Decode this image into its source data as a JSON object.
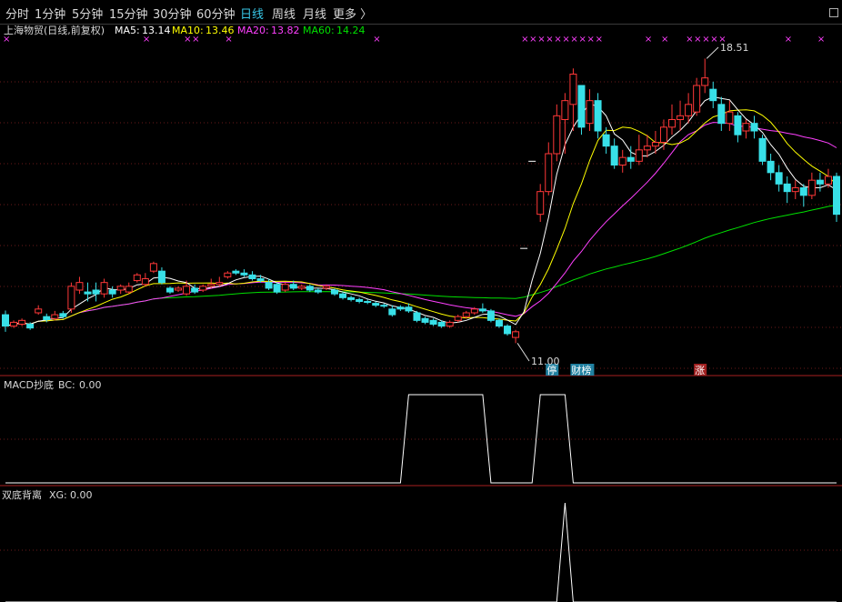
{
  "toolbar": {
    "periods": [
      {
        "label": "分时",
        "x": 6
      },
      {
        "label": "1分钟",
        "x": 38
      },
      {
        "label": "5分钟",
        "x": 79
      },
      {
        "label": "15分钟",
        "x": 120
      },
      {
        "label": "30分钟",
        "x": 168
      },
      {
        "label": "60分钟",
        "x": 216
      },
      {
        "label": "日线",
        "x": 264,
        "active": true
      },
      {
        "label": "周线",
        "x": 299
      },
      {
        "label": "月线",
        "x": 333
      },
      {
        "label": "更多 〉",
        "x": 366
      }
    ]
  },
  "colors": {
    "up": "#ff3838",
    "down": "#38e0e8",
    "ma5": "#ffffff",
    "ma10": "#ffff00",
    "ma20": "#ff40ff",
    "ma60": "#00e000",
    "frame": "#a82020",
    "grid": "#6a1a1a",
    "signal": "#ffffff",
    "marker": "#ff40ff"
  },
  "main_panel": {
    "name": "上海物贸(日线,前复权)",
    "legend": [
      {
        "label": "MA5:",
        "value": "13.14",
        "color": "#ffffff"
      },
      {
        "label": "MA10:",
        "value": "13.46",
        "color": "#ffff00"
      },
      {
        "label": "MA20:",
        "value": "13.82",
        "color": "#ff40ff"
      },
      {
        "label": "MA60:",
        "value": "14.24",
        "color": "#00e000"
      }
    ],
    "high_label": "18.51",
    "low_label": "11.00",
    "event_tags": [
      {
        "text": "停",
        "index": 66,
        "bg": "#2080a0",
        "fg": "#ffffff"
      },
      {
        "text": "财榜",
        "index": 69,
        "bg": "#2080a0",
        "fg": "#ffffff"
      },
      {
        "text": "涨",
        "index": 84,
        "bg": "#a02020",
        "fg": "#ffffff"
      }
    ],
    "markers_top": [
      0,
      17,
      22,
      23,
      27,
      45,
      63,
      64,
      65,
      66,
      67,
      68,
      69,
      70,
      71,
      72,
      78,
      80,
      83,
      84,
      85,
      86,
      87,
      95,
      99
    ]
  },
  "macd_panel": {
    "title": "MACD抄底",
    "indicator": "BC:",
    "value": "0.00"
  },
  "xg_panel": {
    "title": "双底背离",
    "indicator": "XG:",
    "value": "0.00"
  },
  "chart_data": {
    "type": "candlestick",
    "ylim": [
      10.6,
      19.0
    ],
    "candles": [
      [
        11.75,
        11.45,
        11.86,
        11.3
      ],
      [
        11.45,
        11.55,
        11.6,
        11.4
      ],
      [
        11.5,
        11.6,
        11.65,
        11.45
      ],
      [
        11.5,
        11.4,
        11.55,
        11.35
      ],
      [
        11.8,
        11.9,
        12.0,
        11.75
      ],
      [
        11.7,
        11.62,
        11.78,
        11.55
      ],
      [
        11.65,
        11.75,
        11.85,
        11.6
      ],
      [
        11.78,
        11.7,
        11.85,
        11.65
      ],
      [
        11.9,
        12.5,
        12.6,
        11.8
      ],
      [
        12.4,
        12.6,
        12.75,
        12.3
      ],
      [
        12.35,
        12.3,
        12.6,
        12.1
      ],
      [
        12.4,
        12.3,
        12.6,
        12.1
      ],
      [
        12.3,
        12.6,
        12.7,
        12.2
      ],
      [
        12.4,
        12.3,
        12.5,
        12.2
      ],
      [
        12.4,
        12.5,
        12.55,
        12.3
      ],
      [
        12.35,
        12.5,
        12.6,
        12.3
      ],
      [
        12.65,
        12.8,
        12.85,
        12.6
      ],
      [
        12.55,
        12.7,
        12.85,
        12.5
      ],
      [
        12.9,
        13.1,
        13.15,
        12.85
      ],
      [
        12.9,
        12.6,
        13.0,
        12.55
      ],
      [
        12.45,
        12.35,
        12.5,
        12.3
      ],
      [
        12.4,
        12.45,
        12.5,
        12.35
      ],
      [
        12.3,
        12.5,
        12.65,
        12.25
      ],
      [
        12.45,
        12.35,
        12.55,
        12.3
      ],
      [
        12.4,
        12.5,
        12.55,
        12.35
      ],
      [
        12.5,
        12.55,
        12.7,
        12.45
      ],
      [
        12.55,
        12.6,
        12.75,
        12.5
      ],
      [
        12.75,
        12.85,
        12.9,
        12.7
      ],
      [
        12.9,
        12.85,
        12.95,
        12.8
      ],
      [
        12.85,
        12.8,
        12.95,
        12.75
      ],
      [
        12.8,
        12.7,
        12.9,
        12.65
      ],
      [
        12.7,
        12.65,
        12.8,
        12.6
      ],
      [
        12.6,
        12.45,
        12.7,
        12.4
      ],
      [
        12.55,
        12.35,
        12.6,
        12.3
      ],
      [
        12.4,
        12.55,
        12.6,
        12.35
      ],
      [
        12.55,
        12.45,
        12.65,
        12.4
      ],
      [
        12.45,
        12.5,
        12.55,
        12.4
      ],
      [
        12.5,
        12.4,
        12.55,
        12.35
      ],
      [
        12.4,
        12.35,
        12.45,
        12.3
      ],
      [
        12.45,
        12.5,
        12.55,
        12.4
      ],
      [
        12.4,
        12.3,
        12.45,
        12.25
      ],
      [
        12.3,
        12.2,
        12.35,
        12.15
      ],
      [
        12.2,
        12.15,
        12.25,
        12.1
      ],
      [
        12.15,
        12.1,
        12.2,
        12.05
      ],
      [
        12.1,
        12.08,
        12.15,
        12.03
      ],
      [
        12.05,
        12.0,
        12.1,
        11.95
      ],
      [
        12.0,
        11.98,
        12.05,
        11.93
      ],
      [
        11.9,
        11.75,
        12.0,
        11.7
      ],
      [
        11.95,
        11.9,
        12.0,
        11.85
      ],
      [
        11.95,
        11.85,
        12.05,
        11.8
      ],
      [
        11.8,
        11.6,
        11.85,
        11.55
      ],
      [
        11.65,
        11.55,
        11.7,
        11.5
      ],
      [
        11.6,
        11.5,
        11.65,
        11.45
      ],
      [
        11.55,
        11.45,
        11.6,
        11.4
      ],
      [
        11.45,
        11.55,
        11.6,
        11.4
      ],
      [
        11.6,
        11.7,
        11.75,
        11.55
      ],
      [
        11.7,
        11.8,
        11.85,
        11.65
      ],
      [
        11.8,
        11.9,
        11.95,
        11.75
      ],
      [
        11.9,
        11.85,
        12.05,
        11.8
      ],
      [
        11.85,
        11.6,
        11.9,
        11.55
      ],
      [
        11.6,
        11.45,
        11.65,
        11.4
      ],
      [
        11.45,
        11.25,
        11.5,
        11.2
      ],
      [
        11.15,
        11.3,
        11.35,
        11.0
      ],
      [
        13.5,
        13.5,
        13.5,
        13.5
      ],
      [
        15.8,
        15.8,
        15.8,
        15.8
      ],
      [
        14.4,
        15.0,
        15.2,
        14.2
      ],
      [
        15.0,
        16.0,
        16.3,
        14.9
      ],
      [
        16.0,
        17.0,
        17.3,
        15.8
      ],
      [
        16.9,
        17.4,
        17.6,
        16.0
      ],
      [
        17.3,
        18.1,
        18.25,
        16.6
      ],
      [
        17.8,
        16.7,
        17.8,
        16.5
      ],
      [
        16.8,
        17.4,
        17.7,
        16.6
      ],
      [
        17.4,
        16.6,
        17.6,
        16.4
      ],
      [
        16.5,
        16.2,
        16.7,
        16.0
      ],
      [
        16.2,
        15.7,
        16.4,
        15.6
      ],
      [
        15.7,
        15.9,
        16.1,
        15.5
      ],
      [
        15.9,
        15.8,
        16.2,
        15.6
      ],
      [
        15.8,
        16.1,
        16.5,
        15.7
      ],
      [
        16.1,
        16.2,
        16.5,
        15.9
      ],
      [
        16.2,
        16.3,
        16.6,
        16.0
      ],
      [
        16.3,
        16.7,
        16.9,
        16.1
      ],
      [
        16.7,
        16.9,
        17.3,
        16.5
      ],
      [
        16.9,
        17.0,
        17.4,
        16.6
      ],
      [
        17.0,
        17.3,
        17.6,
        16.8
      ],
      [
        17.1,
        17.8,
        18.0,
        17.0
      ],
      [
        17.8,
        18.0,
        18.51,
        17.6
      ],
      [
        17.7,
        17.4,
        17.9,
        17.2
      ],
      [
        17.3,
        16.8,
        17.5,
        16.6
      ],
      [
        16.8,
        17.1,
        17.4,
        16.6
      ],
      [
        17.0,
        16.5,
        17.1,
        16.3
      ],
      [
        16.6,
        16.8,
        16.9,
        16.4
      ],
      [
        16.8,
        16.6,
        17.0,
        16.4
      ],
      [
        16.4,
        15.8,
        16.5,
        15.7
      ],
      [
        15.8,
        15.5,
        16.0,
        15.3
      ],
      [
        15.5,
        15.2,
        15.7,
        15.0
      ],
      [
        15.2,
        15.0,
        15.4,
        14.7
      ],
      [
        15.0,
        15.1,
        15.3,
        14.8
      ],
      [
        15.1,
        14.9,
        15.2,
        14.6
      ],
      [
        14.9,
        15.3,
        15.5,
        14.8
      ],
      [
        15.3,
        15.2,
        15.5,
        15.0
      ],
      [
        15.2,
        15.4,
        15.6,
        15.1
      ],
      [
        15.4,
        14.4,
        15.5,
        14.2
      ]
    ],
    "macd_signal": [
      0,
      0,
      0,
      0,
      0,
      0,
      0,
      0,
      0,
      0,
      0,
      0,
      0,
      0,
      0,
      0,
      0,
      0,
      0,
      0,
      0,
      0,
      0,
      0,
      0,
      0,
      0,
      0,
      0,
      0,
      0,
      0,
      0,
      0,
      0,
      0,
      0,
      0,
      0,
      0,
      0,
      0,
      0,
      0,
      0,
      0,
      0,
      0,
      0,
      1,
      1,
      1,
      1,
      1,
      1,
      1,
      1,
      1,
      1,
      0,
      0,
      0,
      0,
      0,
      0,
      1,
      1,
      1,
      1,
      0,
      0,
      0,
      0,
      0,
      0,
      0,
      0,
      0,
      0,
      0,
      0,
      0,
      0,
      0,
      0,
      0,
      0,
      0,
      0,
      0,
      0,
      0,
      0,
      0,
      0,
      0,
      0,
      0,
      0,
      0,
      0,
      0
    ],
    "xg_signal": [
      0,
      0,
      0,
      0,
      0,
      0,
      0,
      0,
      0,
      0,
      0,
      0,
      0,
      0,
      0,
      0,
      0,
      0,
      0,
      0,
      0,
      0,
      0,
      0,
      0,
      0,
      0,
      0,
      0,
      0,
      0,
      0,
      0,
      0,
      0,
      0,
      0,
      0,
      0,
      0,
      0,
      0,
      0,
      0,
      0,
      0,
      0,
      0,
      0,
      0,
      0,
      0,
      0,
      0,
      0,
      0,
      0,
      0,
      0,
      0,
      0,
      0,
      0,
      0,
      0,
      0,
      0,
      0,
      1,
      0,
      0,
      0,
      0,
      0,
      0,
      0,
      0,
      0,
      0,
      0,
      0,
      0,
      0,
      0,
      0,
      0,
      0,
      0,
      0,
      0,
      0,
      0,
      0,
      0,
      0,
      0,
      0,
      0,
      0,
      0,
      0,
      0
    ]
  }
}
